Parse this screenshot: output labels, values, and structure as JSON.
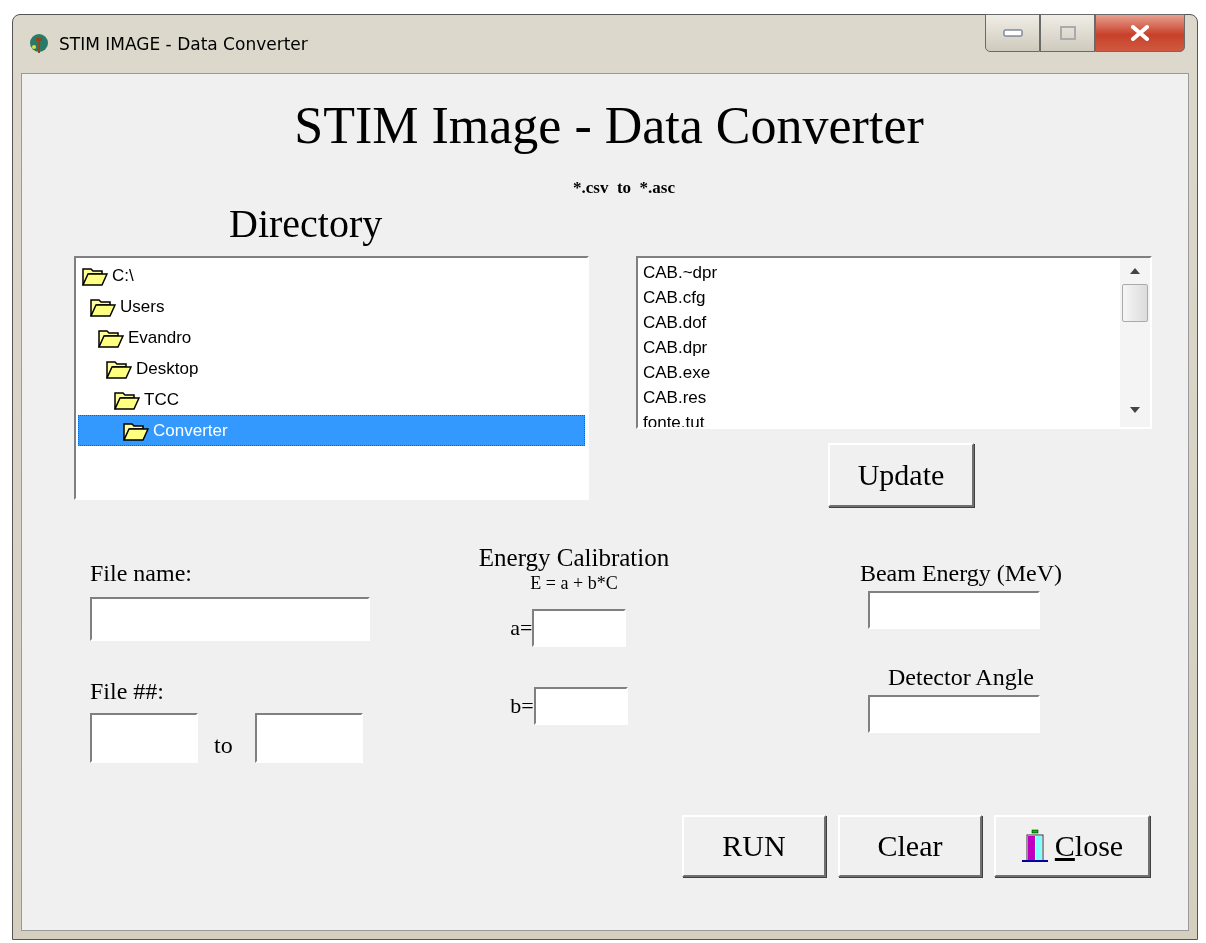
{
  "window": {
    "title": "STIM IMAGE - Data Converter"
  },
  "heading": "STIM Image - Data Converter",
  "subtitle": "*.csv  to  *.asc",
  "directory": {
    "label": "Directory",
    "tree": [
      {
        "label": "C:\\",
        "selected": false,
        "expanded": true,
        "children": [
          {
            "label": "Users",
            "selected": false,
            "expanded": true,
            "children": [
              {
                "label": "Evandro",
                "selected": false,
                "expanded": true,
                "children": [
                  {
                    "label": "Desktop",
                    "selected": false,
                    "expanded": true,
                    "children": [
                      {
                        "label": "TCC",
                        "selected": false,
                        "expanded": true,
                        "children": [
                          {
                            "label": "Converter",
                            "selected": true,
                            "expanded": true
                          }
                        ]
                      }
                    ]
                  }
                ]
              }
            ]
          }
        ]
      }
    ]
  },
  "files": [
    "CAB.~dpr",
    "CAB.cfg",
    "CAB.dof",
    "CAB.dpr",
    "CAB.exe",
    "CAB.res",
    "fonte.tut"
  ],
  "update_button": "Update",
  "file_name": {
    "label": "File name:"
  },
  "file_numbers": {
    "label": "File ##:",
    "separator": "to"
  },
  "energy_calibration": {
    "label": "Energy Calibration",
    "formula": "E = a + b*C",
    "fields": [
      "a=",
      "b="
    ]
  },
  "beam_energy": {
    "label": "Beam Energy (MeV)"
  },
  "detector_angle": {
    "label": "Detector Angle"
  },
  "buttons": [
    {
      "label": "RUN",
      "kind": "text",
      "mnemonic": false
    },
    {
      "label": "Clear",
      "kind": "text",
      "mnemonic": false
    },
    {
      "label": "Close",
      "kind": "exit",
      "mnemonic": true
    }
  ]
}
